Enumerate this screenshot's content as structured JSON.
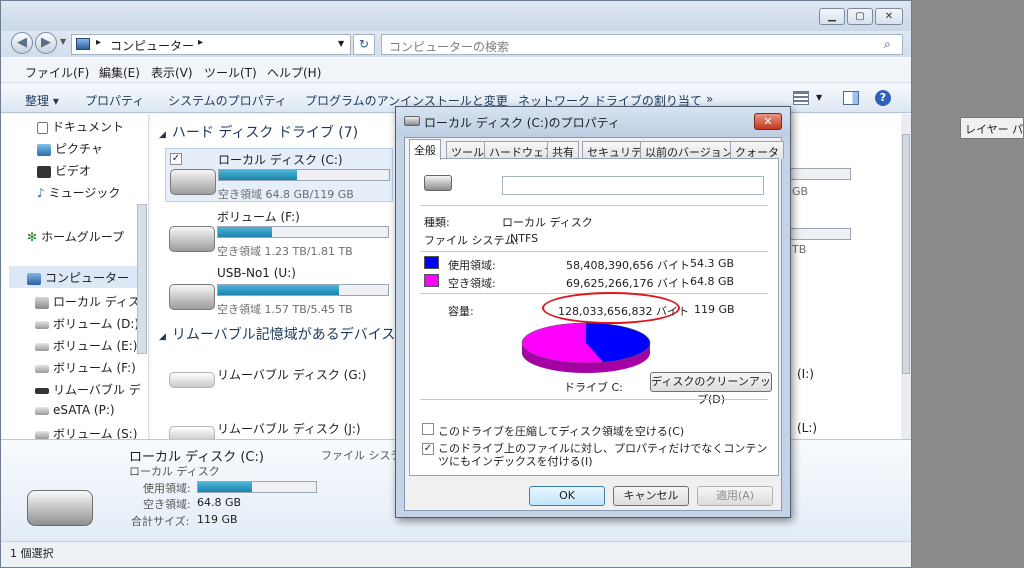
{
  "explorer": {
    "address": "コンピューター",
    "search_placeholder": "コンピューターの検索",
    "menus": [
      "ファイル(F)",
      "編集(E)",
      "表示(V)",
      "ツール(T)",
      "ヘルプ(H)"
    ],
    "commands": [
      "整理 ▾",
      "プロパティ",
      "システムのプロパティ",
      "プログラムのアンインストールと変更",
      "ネットワーク ドライブの割り当て",
      "»"
    ],
    "nav": {
      "favorites": [
        "ドキュメント",
        "ピクチャ",
        "ビデオ",
        "ミュージック"
      ],
      "homegroup": "ホームグループ",
      "computer": "コンピューター",
      "drives": [
        "ローカル ディス",
        "ボリューム (D:)",
        "ボリューム (E:)",
        "ボリューム (F:)",
        "リムーバブル デ",
        "eSATA (P:)",
        "ボリューム (S:)"
      ]
    },
    "sections": {
      "hdd": "ハード ディスク ドライブ (7)",
      "removable": "リムーバブル記憶域があるデバイス"
    },
    "hdd_drives": [
      {
        "name": "ローカル ディスク (C:)",
        "info": "空き領域 64.8 GB/119 GB",
        "used_fraction": 0.46
      },
      {
        "name": "ボリューム (F:)",
        "info": "空き領域 1.23 TB/1.81 TB",
        "used_fraction": 0.32
      },
      {
        "name": "USB-No1 (U:)",
        "info": "空き領域 1.57 TB/5.45 TB",
        "used_fraction": 0.71
      }
    ],
    "removable_drives": [
      "リムーバブル ディスク (G:)",
      "リムーバブル ディスク (J:)"
    ],
    "right_partial": {
      "gb1": "GB",
      "tb1": "TB",
      "i": "(I:)",
      "l": "(L:)"
    },
    "details": {
      "name": "ローカル ディスク (C:)",
      "type": "ローカル ディスク",
      "used_label": "使用領域:",
      "free_label": "空き領域:",
      "free_value": "64.8 GB",
      "total_label": "合計サイズ:",
      "total_value": "119 GB",
      "fs_partial": "ファイル システ",
      "used_fraction": 0.46
    },
    "status": "1 個選択"
  },
  "layer_label": "レイヤー パレ",
  "dialog": {
    "title": "ローカル ディスク (C:)のプロパティ",
    "tabs": [
      "全般",
      "ツール",
      "ハードウェア",
      "共有",
      "セキュリティ",
      "以前のバージョン",
      "クォータ"
    ],
    "label_value": "",
    "type_label": "種類:",
    "type_value": "ローカル ディスク",
    "fs_label": "ファイル システム:",
    "fs_value": "NTFS",
    "used_label": "使用領域:",
    "used_bytes": "58,408,390,656 バイト",
    "used_gb": "54.3 GB",
    "free_label": "空き領域:",
    "free_bytes": "69,625,266,176 バイト",
    "free_gb": "64.8 GB",
    "cap_label": "容量:",
    "cap_bytes": "128,033,656,832 バイト",
    "cap_gb": "119 GB",
    "drive_label": "ドライブ C:",
    "cleanup": "ディスクのクリーンアップ(D)",
    "compress": "このドライブを圧縮してディスク領域を空ける(C)",
    "index": "このドライブ上のファイルに対し、プロパティだけでなくコンテンツにもインデックスを付ける(I)",
    "ok": "OK",
    "cancel": "キャンセル",
    "apply": "適用(A)",
    "used_color": "#0000ff",
    "free_color": "#ff00ff",
    "used_fraction": 0.456
  }
}
